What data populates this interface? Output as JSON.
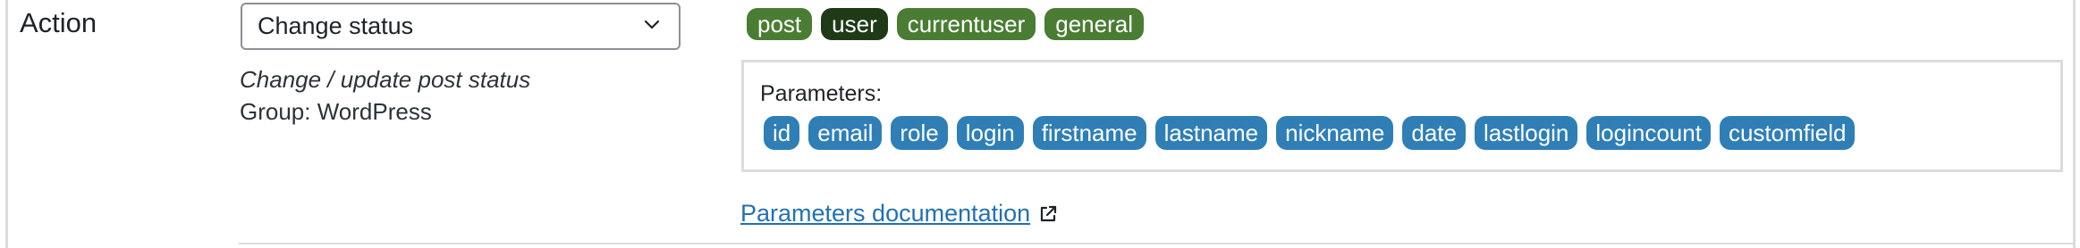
{
  "row": {
    "label": "Action"
  },
  "select": {
    "value": "Change status",
    "icon": "chevron-down-icon"
  },
  "description": "Change / update post status",
  "group_text": "Group: WordPress",
  "tags": [
    "post",
    "user",
    "currentuser",
    "general"
  ],
  "colors": {
    "tag_green": "#4a7d33",
    "tag_dark": "#1e3a17",
    "param_blue": "#2f7fb6",
    "link": "#2271b1"
  },
  "parameters": {
    "title": "Parameters:",
    "items": [
      "id",
      "email",
      "role",
      "login",
      "firstname",
      "lastname",
      "nickname",
      "date",
      "lastlogin",
      "logincount",
      "customfield"
    ]
  },
  "doc_link": {
    "label": "Parameters documentation ",
    "icon": "external-link-icon"
  }
}
